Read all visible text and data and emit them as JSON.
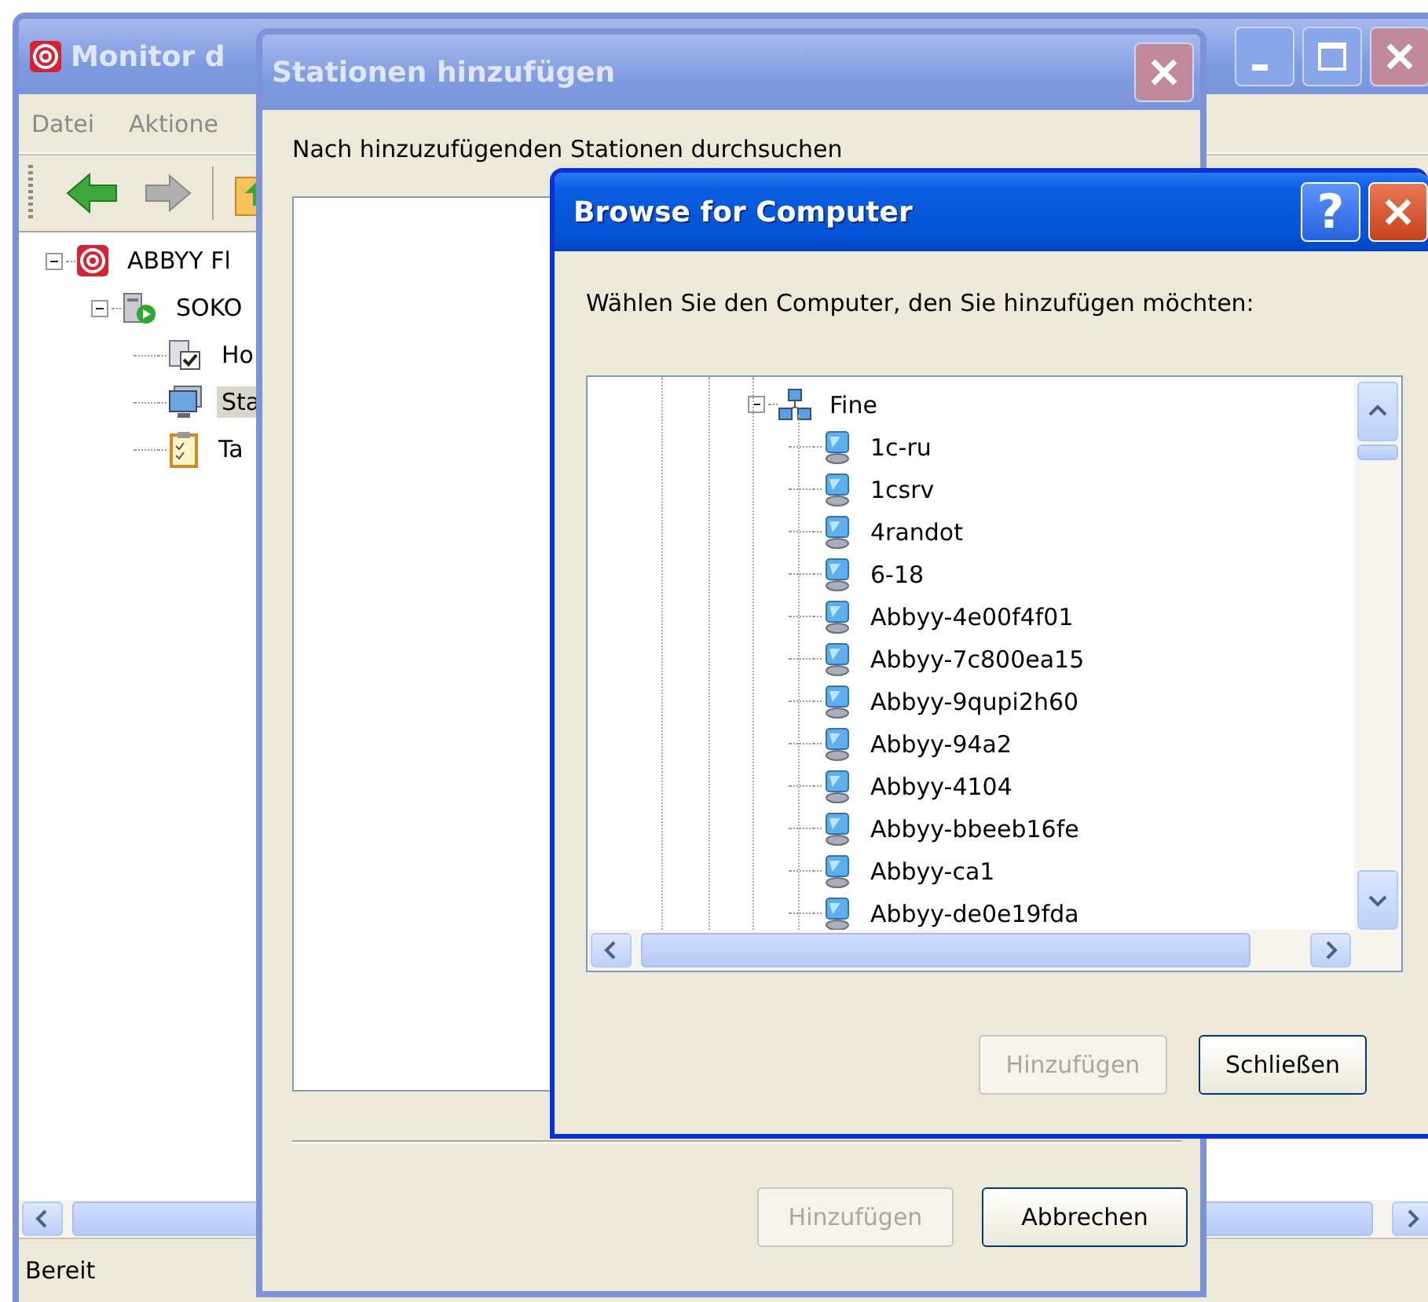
{
  "main_window": {
    "title": "Monitor d",
    "active": false,
    "menu": [
      "Datei",
      "Aktione"
    ],
    "tree": [
      {
        "label": "ABBYY Fl",
        "kind": "app",
        "expanded": true,
        "selected": false,
        "children": [
          {
            "label": "SOKO",
            "kind": "server",
            "expanded": true,
            "selected": false,
            "children": [
              {
                "label": "Ho",
                "kind": "check",
                "selected": false
              },
              {
                "label": "Sta",
                "kind": "stations",
                "selected": true
              },
              {
                "label": "Ta",
                "kind": "tasks",
                "selected": false
              }
            ]
          }
        ]
      }
    ],
    "status_bar": "Bereit"
  },
  "add_dialog": {
    "title": "Stationen hinzufügen",
    "active": false,
    "label": "Nach hinzuzufügenden Stationen durchsuchen",
    "buttons": [
      {
        "label": "Hinzufügen",
        "disabled": true
      },
      {
        "label": "Abbrechen",
        "disabled": false
      }
    ]
  },
  "browse_dialog": {
    "title": "Browse for Computer",
    "active": true,
    "help": "?",
    "prompt": "Wählen Sie den Computer, den Sie hinzufügen möchten:",
    "tree": [
      {
        "label": "Fine",
        "kind": "network",
        "expanded": true,
        "children": [
          {
            "label": "1c-ru",
            "kind": "computer"
          },
          {
            "label": "1csrv",
            "kind": "computer"
          },
          {
            "label": "4randot",
            "kind": "computer"
          },
          {
            "label": "6-18",
            "kind": "computer"
          },
          {
            "label": "Abbyy-4e00f4f01",
            "kind": "computer"
          },
          {
            "label": "Abbyy-7c800ea15",
            "kind": "computer"
          },
          {
            "label": "Abbyy-9qupi2h60",
            "kind": "computer"
          },
          {
            "label": "Abbyy-94a2",
            "kind": "computer"
          },
          {
            "label": "Abbyy-4104",
            "kind": "computer"
          },
          {
            "label": "Abbyy-bbeeb16fe",
            "kind": "computer"
          },
          {
            "label": "Abbyy-ca1",
            "kind": "computer"
          },
          {
            "label": "Abbyy-de0e19fda",
            "kind": "computer"
          }
        ]
      }
    ],
    "buttons": [
      {
        "label": "Hinzufügen",
        "disabled": true
      },
      {
        "label": "Schließen",
        "disabled": false
      }
    ]
  }
}
